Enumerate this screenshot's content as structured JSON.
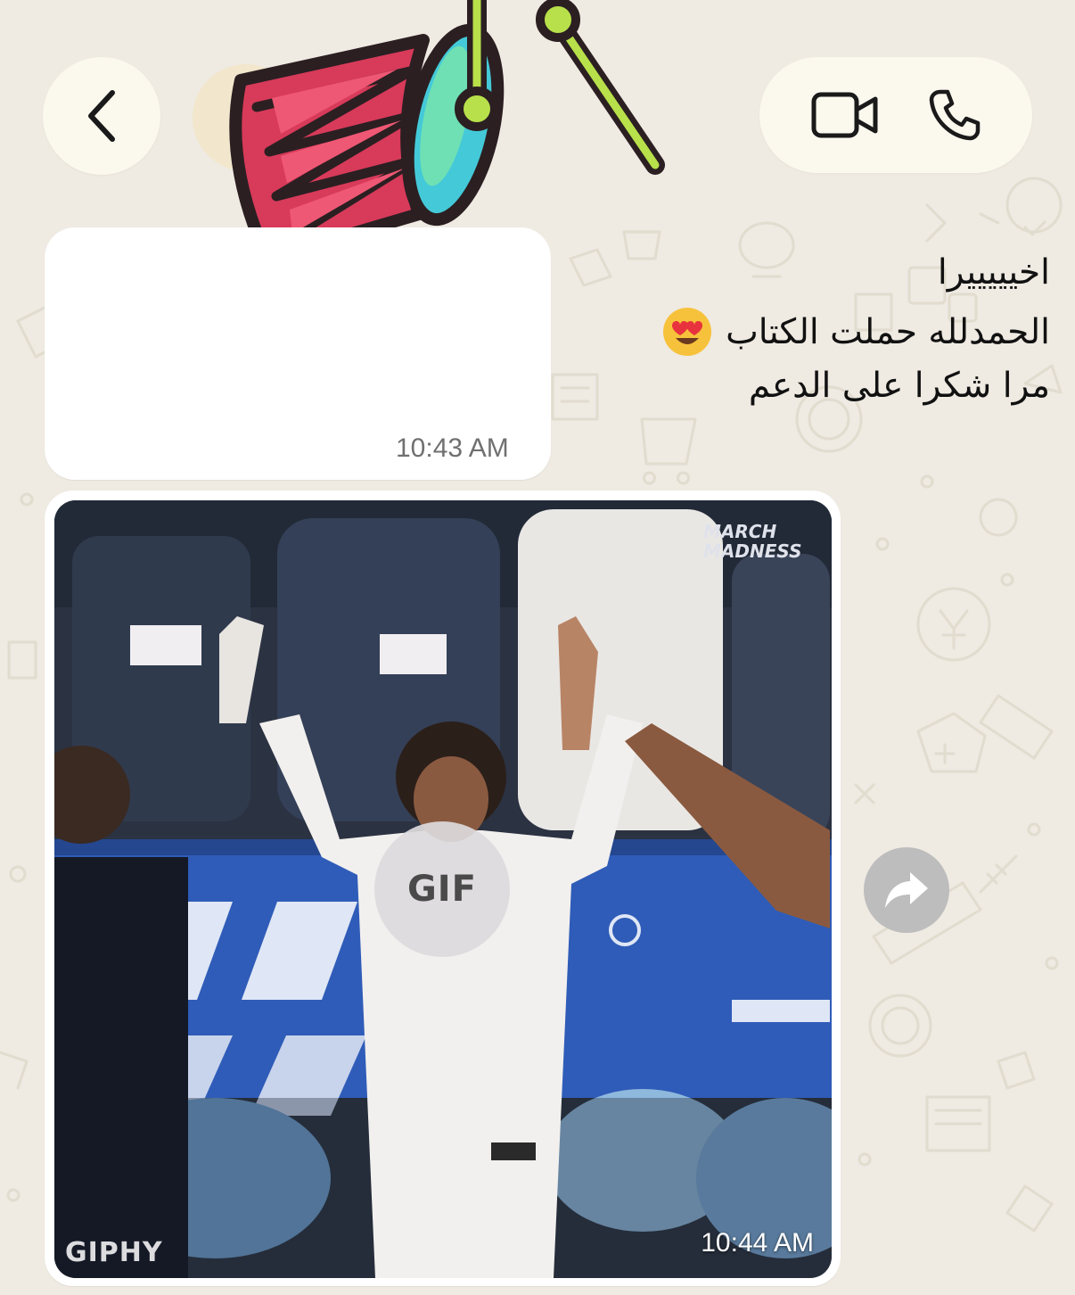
{
  "header": {
    "back_icon": "chevron-left-icon",
    "video_icon": "video-camera-icon",
    "call_icon": "phone-icon"
  },
  "sticker": {
    "icon": "drum-sticker"
  },
  "messages": [
    {
      "type": "text",
      "lines": [
        "اخيييييرا",
        "الحمدلله حملت الكتاب",
        "مرا شكرا على الدعم"
      ],
      "emoji": "heart-eyes-emoji",
      "time": "10:43 AM"
    },
    {
      "type": "gif",
      "badge": "GIF",
      "source_label": "GIPHY",
      "overlay_logo": [
        "MARCH",
        "MADNESS"
      ],
      "time": "10:44 AM"
    }
  ],
  "forward": {
    "icon": "forward-arrow-icon"
  },
  "colors": {
    "background": "#efeae2",
    "bubble": "#ffffff",
    "pill": "#fbf8ee",
    "timestamp": "#707070"
  }
}
